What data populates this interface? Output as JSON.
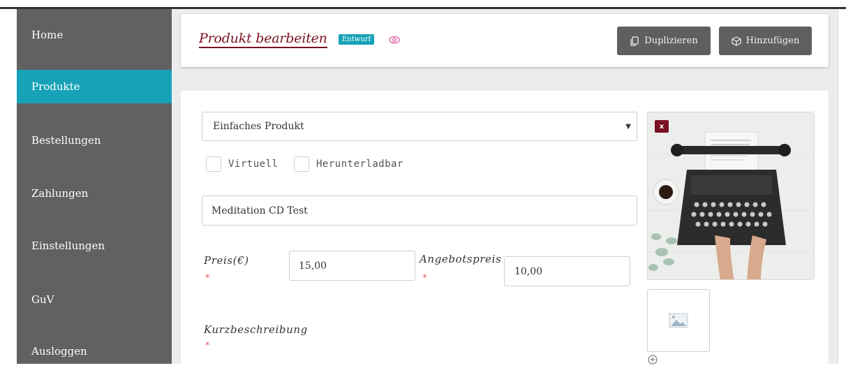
{
  "sidebar": {
    "items": [
      {
        "label": "Home",
        "active": false
      },
      {
        "label": "Produkte",
        "active": true
      },
      {
        "label": "Bestellungen",
        "active": false
      },
      {
        "label": "Zahlungen",
        "active": false
      },
      {
        "label": "Einstellungen",
        "active": false
      },
      {
        "label": "GuV",
        "active": false
      },
      {
        "label": "Ausloggen",
        "active": false
      }
    ]
  },
  "header": {
    "title": "Produkt bearbeiten",
    "status_badge": "Entwurf",
    "preview_icon": "eye-icon",
    "duplicate_label": "Duplizieren",
    "duplicate_icon": "copy-icon",
    "add_label": "Hinzufügen",
    "add_icon": "cube-icon"
  },
  "form": {
    "product_type": "Einfaches Produkt",
    "virtual_label": "Virtuell",
    "downloadable_label": "Herunterladbar",
    "product_name": "Meditation CD Test",
    "price_label": "Preis(€)",
    "price_value": "15,00",
    "sale_price_label": "Angebotspreis",
    "sale_price_value": "10,00",
    "short_description_label": "Kurzbeschreibung",
    "required_marker": "*"
  },
  "media": {
    "remove_label": "x",
    "product_image": "typewriter-photo",
    "gallery_placeholder_icon": "image-placeholder-icon",
    "add_gallery_icon": "plus-circle-icon"
  },
  "colors": {
    "sidebar_bg": "#616161",
    "active_item": "#17a2b8",
    "title": "#7a1024",
    "button_bg": "#5f5f5f",
    "required": "#e05a5a"
  }
}
